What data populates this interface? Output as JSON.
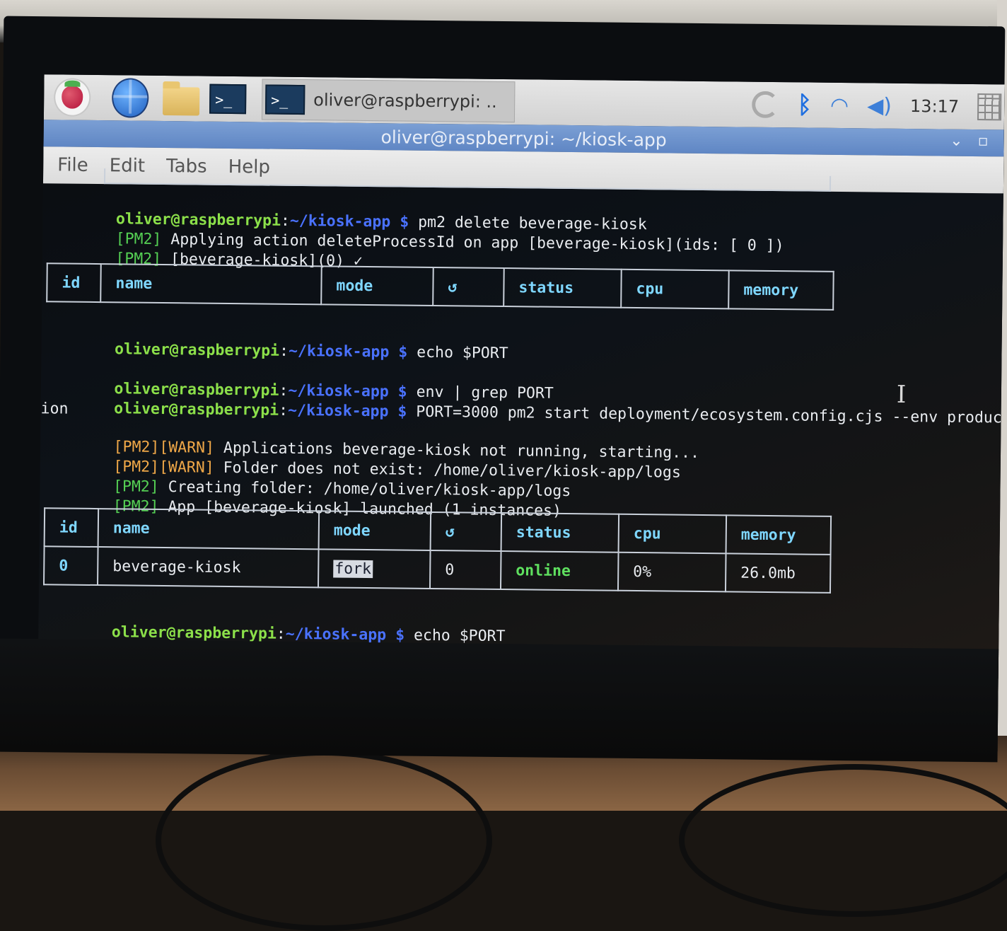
{
  "taskbar": {
    "task_title": "oliver@raspberrypi: ..",
    "clock": "13:17"
  },
  "window": {
    "title": "oliver@raspberrypi: ~/kiosk-app",
    "controls": {
      "minimize": "⌄",
      "maximize": "▫"
    }
  },
  "menu": [
    "File",
    "Edit",
    "Tabs",
    "Help"
  ],
  "prompt": {
    "user": "oliver@raspberrypi",
    "sep": ":",
    "path": "~/kiosk-app",
    "sym": " $ "
  },
  "terminal": {
    "cmd1": "pm2 delete beverage-kiosk",
    "out1": [
      {
        "tag": "[PM2]",
        "text": " Applying action deleteProcessId on app [beverage-kiosk](ids: [ 0 ])"
      },
      {
        "tag": "[PM2]",
        "text": " [beverage-kiosk](0) ✓"
      }
    ],
    "cmd2": "echo $PORT",
    "cmd3": "env | grep PORT",
    "cmd4": "PORT=3000 pm2 start deployment/ecosystem.config.cjs --env produc",
    "cmd4_wrap": "ion",
    "out4": [
      {
        "tag": "[PM2][WARN]",
        "text": " Applications beverage-kiosk not running, starting...",
        "kind": "warn"
      },
      {
        "tag": "[PM2][WARN]",
        "text": " Folder does not exist: /home/oliver/kiosk-app/logs",
        "kind": "warn"
      },
      {
        "tag": "[PM2]",
        "text": " Creating folder: /home/oliver/kiosk-app/logs",
        "kind": "info"
      },
      {
        "tag": "[PM2]",
        "text": " App [beverage-kiosk] launched (1 instances)",
        "kind": "info"
      }
    ],
    "cmd5": "echo $PORT"
  },
  "pm2_table": {
    "headers": [
      "id",
      "name",
      "mode",
      "↺",
      "status",
      "cpu",
      "memory"
    ],
    "rows": [
      [
        "0",
        "beverage-kiosk",
        "fork",
        "0",
        "online",
        "0%",
        "26.0mb"
      ]
    ]
  },
  "colors": {
    "prompt_user": "#8ce04a",
    "prompt_path": "#4a72ff",
    "pm2_tag": "#55d054",
    "warn_tag": "#f0a848",
    "table_header": "#7fd7ff"
  }
}
